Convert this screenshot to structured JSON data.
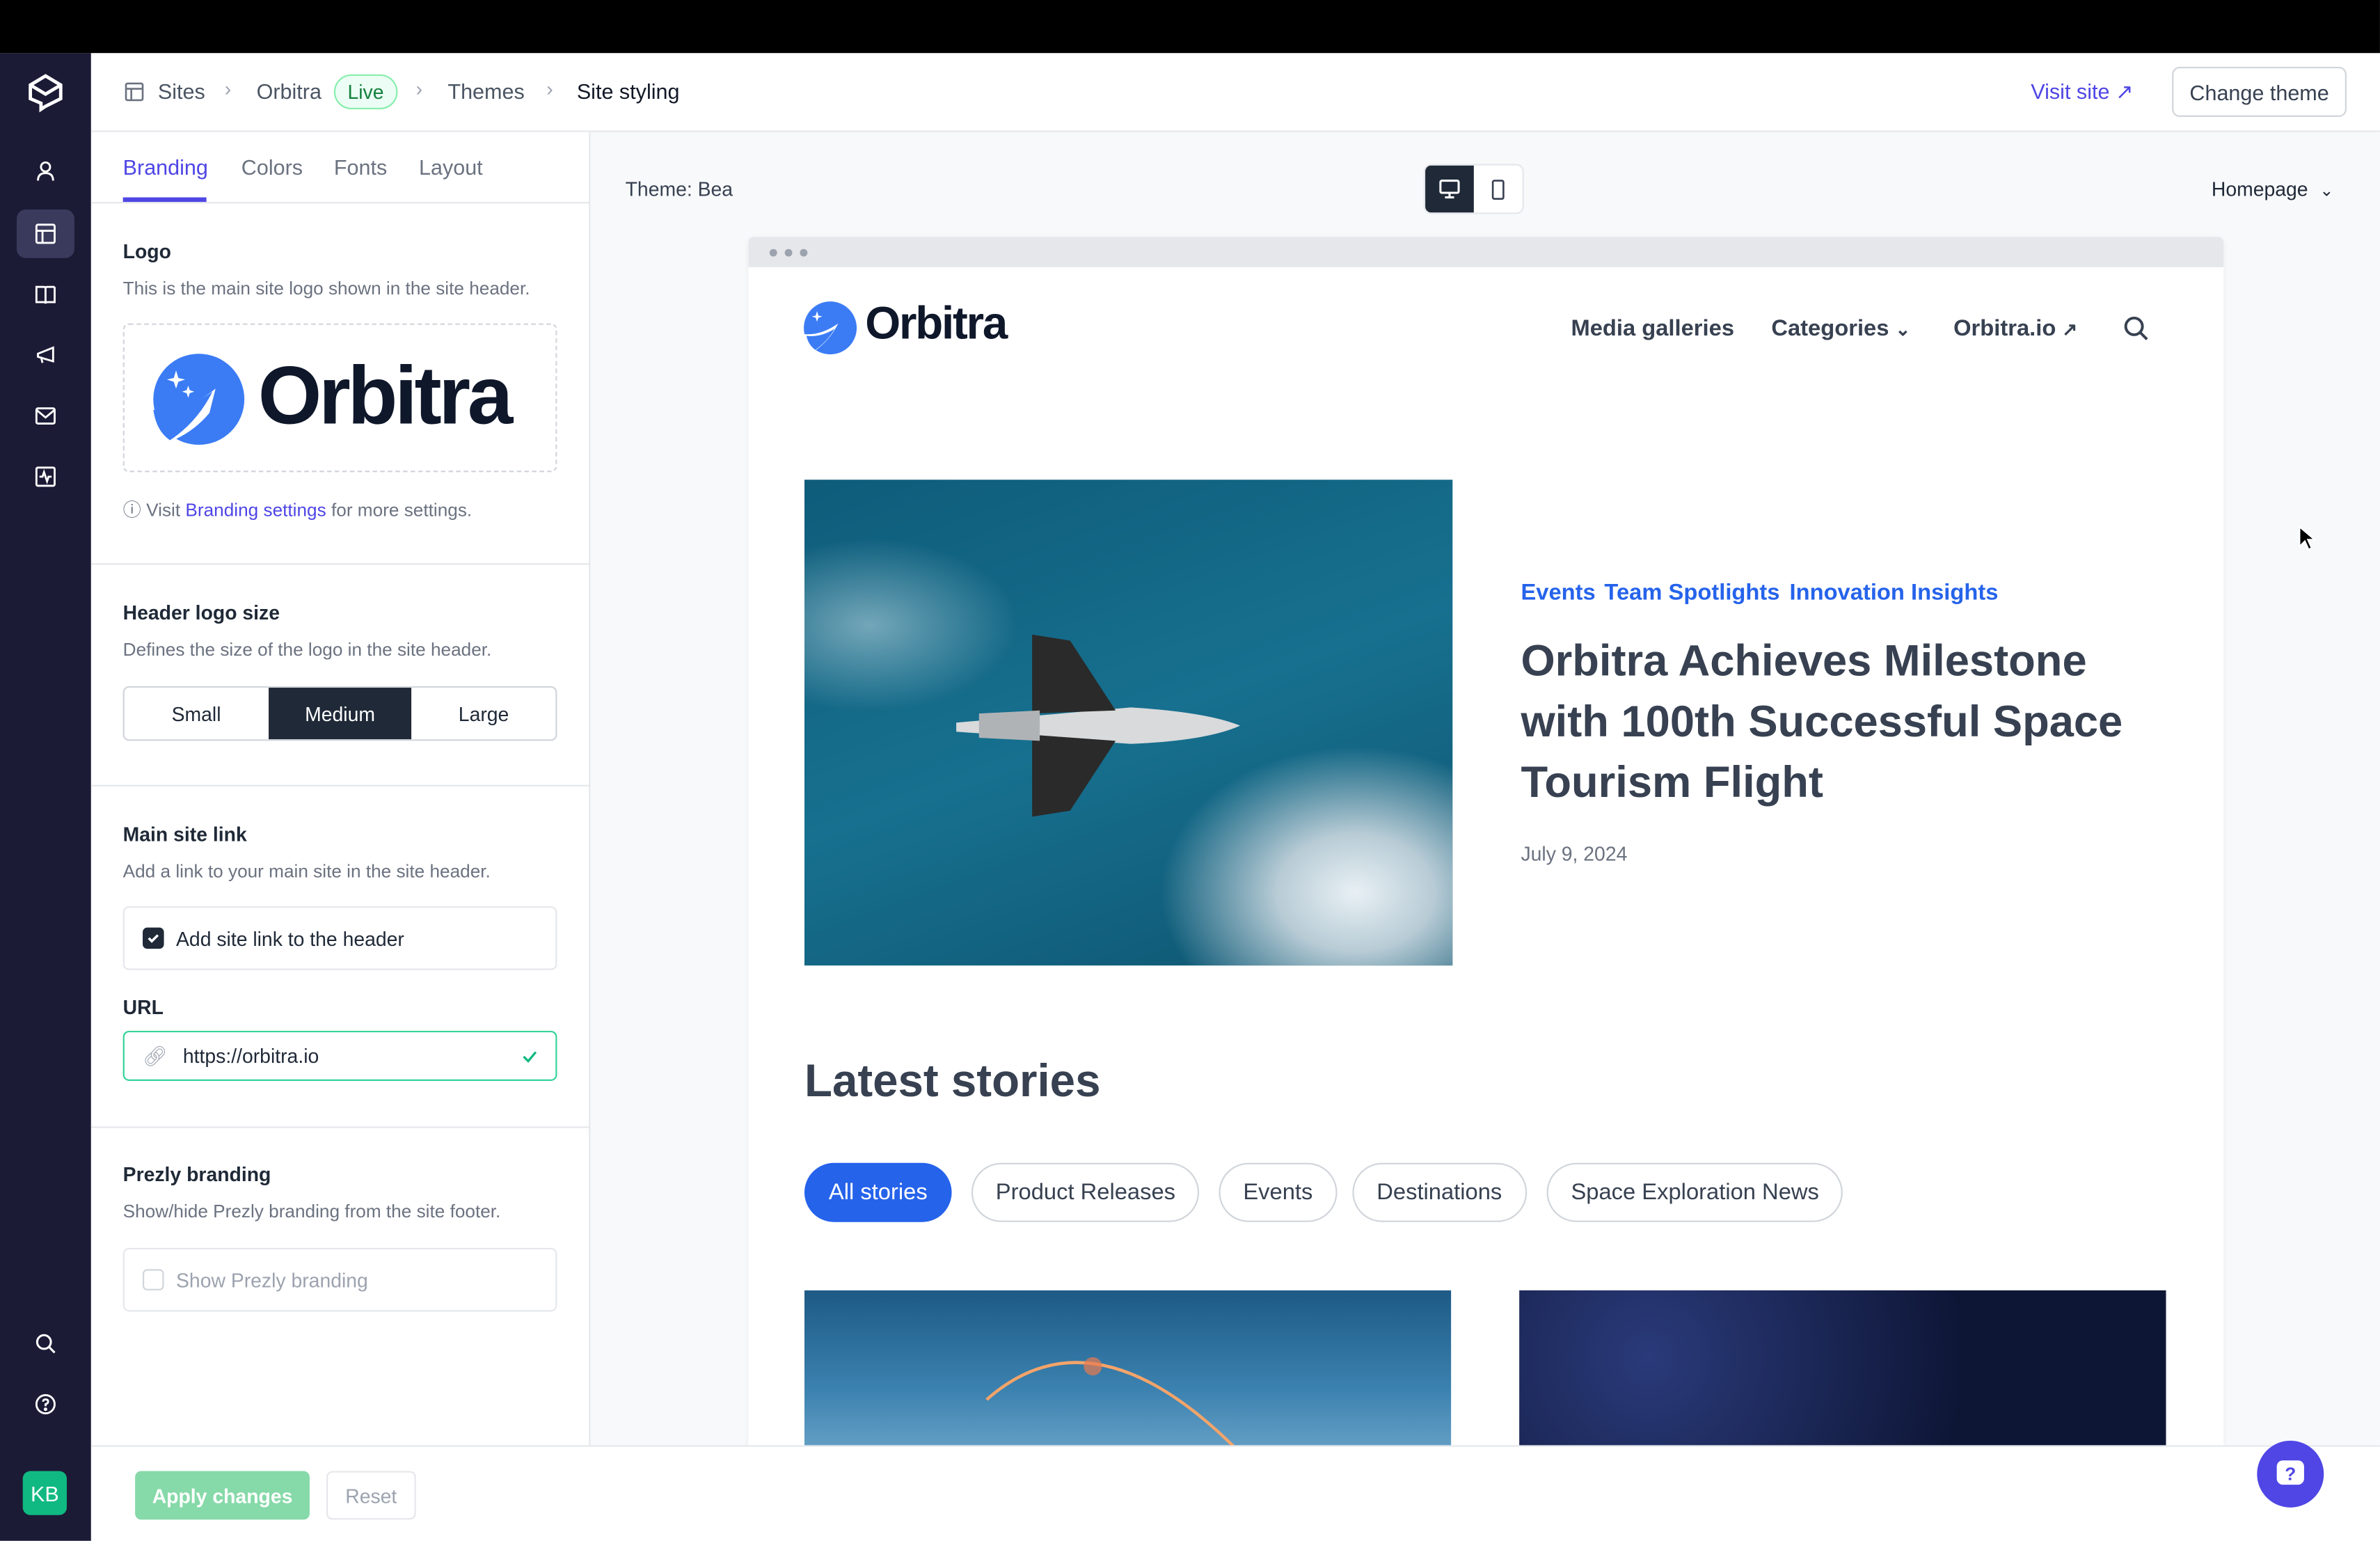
{
  "breadcrumb": {
    "sites": "Sites",
    "site": "Orbitra",
    "status": "Live",
    "themes": "Themes",
    "current": "Site styling"
  },
  "header": {
    "visit_site": "Visit site",
    "change_theme": "Change theme"
  },
  "nav": {
    "avatar_initials": "KB",
    "icons": [
      "prezly-logo-icon",
      "user-icon",
      "layout-icon",
      "book-icon",
      "megaphone-icon",
      "mail-icon",
      "activity-icon",
      "search-icon",
      "help-icon"
    ]
  },
  "panel": {
    "tabs": [
      "Branding",
      "Colors",
      "Fonts",
      "Layout"
    ],
    "active_tab": "Branding",
    "logo": {
      "title": "Logo",
      "desc": "This is the main site logo shown in the site header.",
      "logo_text": "Orbitra",
      "hint_prefix": "Visit",
      "hint_link": "Branding settings",
      "hint_suffix": "for more settings."
    },
    "logo_size": {
      "title": "Header logo size",
      "desc": "Defines the size of the logo in the site header.",
      "options": [
        "Small",
        "Medium",
        "Large"
      ],
      "selected": "Medium"
    },
    "site_link": {
      "title": "Main site link",
      "desc": "Add a link to your main site in the site header.",
      "checkbox_label": "Add site link to the header",
      "checked": true,
      "url_label": "URL",
      "url_value": "https://orbitra.io"
    },
    "prezly": {
      "title": "Prezly branding",
      "desc": "Show/hide Prezly branding from the site footer.",
      "checkbox_label": "Show Prezly branding",
      "checked": false
    }
  },
  "footer": {
    "apply": "Apply changes",
    "reset": "Reset"
  },
  "preview": {
    "theme_label": "Theme: Bea",
    "page_select": "Homepage",
    "device": "desktop",
    "site": {
      "logo_text": "Orbitra",
      "nav": [
        "Media galleries",
        "Categories",
        "Orbitra.io"
      ],
      "hero": {
        "tags": [
          "Events",
          "Team Spotlights",
          "Innovation Insights"
        ],
        "title": "Orbitra Achieves Milestone with 100th Successful Space Tourism Flight",
        "date": "July 9, 2024"
      },
      "latest_title": "Latest stories",
      "filters": [
        "All stories",
        "Product Releases",
        "Events",
        "Destinations",
        "Space Exploration News"
      ],
      "active_filter": "All stories"
    }
  },
  "colors": {
    "accent": "#4f46e5",
    "site_blue": "#2563eb",
    "nav_bg": "#1c1b36",
    "success": "#10b981"
  }
}
